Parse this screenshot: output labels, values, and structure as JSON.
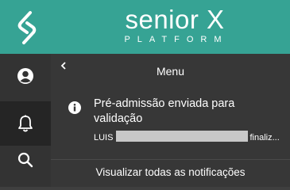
{
  "header": {
    "brand_title": "senior X",
    "brand_subtitle": "PLATFORM",
    "logo_icon": "senior-logo-icon",
    "background": "#36a394"
  },
  "rail": {
    "items": [
      {
        "name": "user-icon"
      },
      {
        "name": "bell-icon",
        "active": true
      },
      {
        "name": "search-icon"
      }
    ]
  },
  "panel": {
    "back_icon": "chevron-left-icon",
    "title": "Menu",
    "notification": {
      "icon": "info-icon",
      "title": "Pré-admissão enviada para validação",
      "desc_prefix": "LUIS",
      "desc_suffix": "finaliz..."
    },
    "view_all_label": "Visualizar todas as notificações"
  }
}
